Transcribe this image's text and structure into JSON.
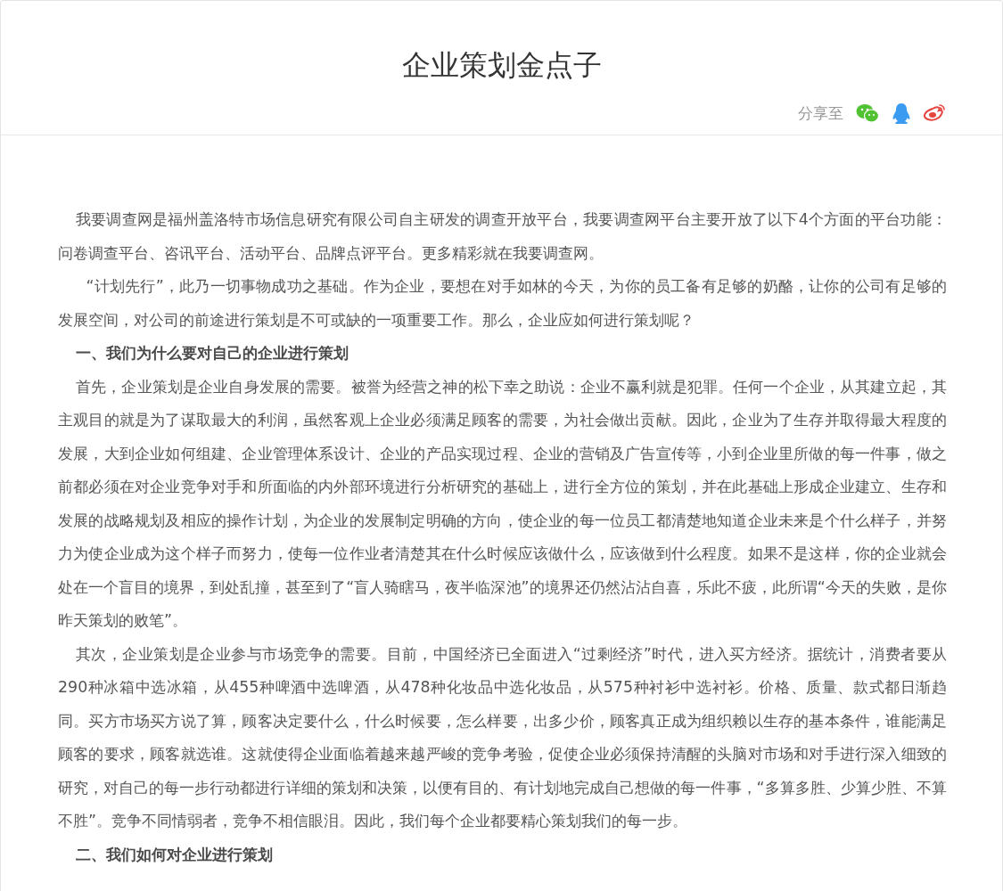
{
  "article": {
    "title": "企业策划金点子",
    "share_label": "分享至",
    "blocks": [
      {
        "kind": "paragraph",
        "text": "我要调查网是福州盖洛特市场信息研究有限公司自主研发的调查开放平台，我要调查网平台主要开放了以下4个方面的平台功能：问卷调查平台、咨讯平台、活动平台、品牌点评平台。更多精彩就在我要调查网。"
      },
      {
        "kind": "paragraph",
        "text": "  “计划先行”，此乃一切事物成功之基础。作为企业，要想在对手如林的今天，为你的员工备有足够的奶酪，让你的公司有足够的发展空间，对公司的前途进行策划是不可或缺的一项重要工作。那么，企业应如何进行策划呢？"
      },
      {
        "kind": "heading",
        "text": "一、我们为什么要对自己的企业进行策划"
      },
      {
        "kind": "paragraph",
        "text": "首先，企业策划是企业自身发展的需要。被誉为经营之神的松下幸之助说：企业不赢利就是犯罪。任何一个企业，从其建立起，其主观目的就是为了谋取最大的利润，虽然客观上企业必须满足顾客的需要，为社会做出贡献。因此，企业为了生存并取得最大程度的发展，大到企业如何组建、企业管理体系设计、企业的产品实现过程、企业的营销及广告宣传等，小到企业里所做的每一件事，做之前都必须在对企业竞争对手和所面临的内外部环境进行分析研究的基础上，进行全方位的策划，并在此基础上形成企业建立、生存和发展的战略规划及相应的操作计划，为企业的发展制定明确的方向，使企业的每一位员工都清楚地知道企业未来是个什么样子，并努力为使企业成为这个样子而努力，使每一位作业者清楚其在什么时候应该做什么，应该做到什么程度。如果不是这样，你的企业就会处在一个盲目的境界，到处乱撞，甚至到了“盲人骑瞎马，夜半临深池”的境界还仍然沾沾自喜，乐此不疲，此所谓“今天的失败，是你昨天策划的败笔”。"
      },
      {
        "kind": "paragraph",
        "text": "其次，企业策划是企业参与市场竞争的需要。目前，中国经济已全面进入“过剩经济”时代，进入买方经济。据统计，消费者要从290种冰箱中选冰箱，从455种啤酒中选啤酒，从478种化妆品中选化妆品，从575种衬衫中选衬衫。价格、质量、款式都日渐趋同。买方市场买方说了算，顾客决定要什么，什么时候要，怎么样要，出多少价，顾客真正成为组织赖以生存的基本条件，谁能满足顾客的要求，顾客就选谁。这就使得企业面临着越来越严峻的竞争考验，促使企业必须保持清醒的头脑对市场和对手进行深入细致的研究，对自己的每一步行动都进行详细的策划和决策，以便有目的、有计划地完成自己想做的每一件事，“多算多胜、少算少胜、不算不胜”。竞争不同情弱者，竞争不相信眼泪。因此，我们每个企业都要精心策划我们的每一步。"
      },
      {
        "kind": "heading",
        "text": "二、我们如何对企业进行策划"
      }
    ]
  }
}
